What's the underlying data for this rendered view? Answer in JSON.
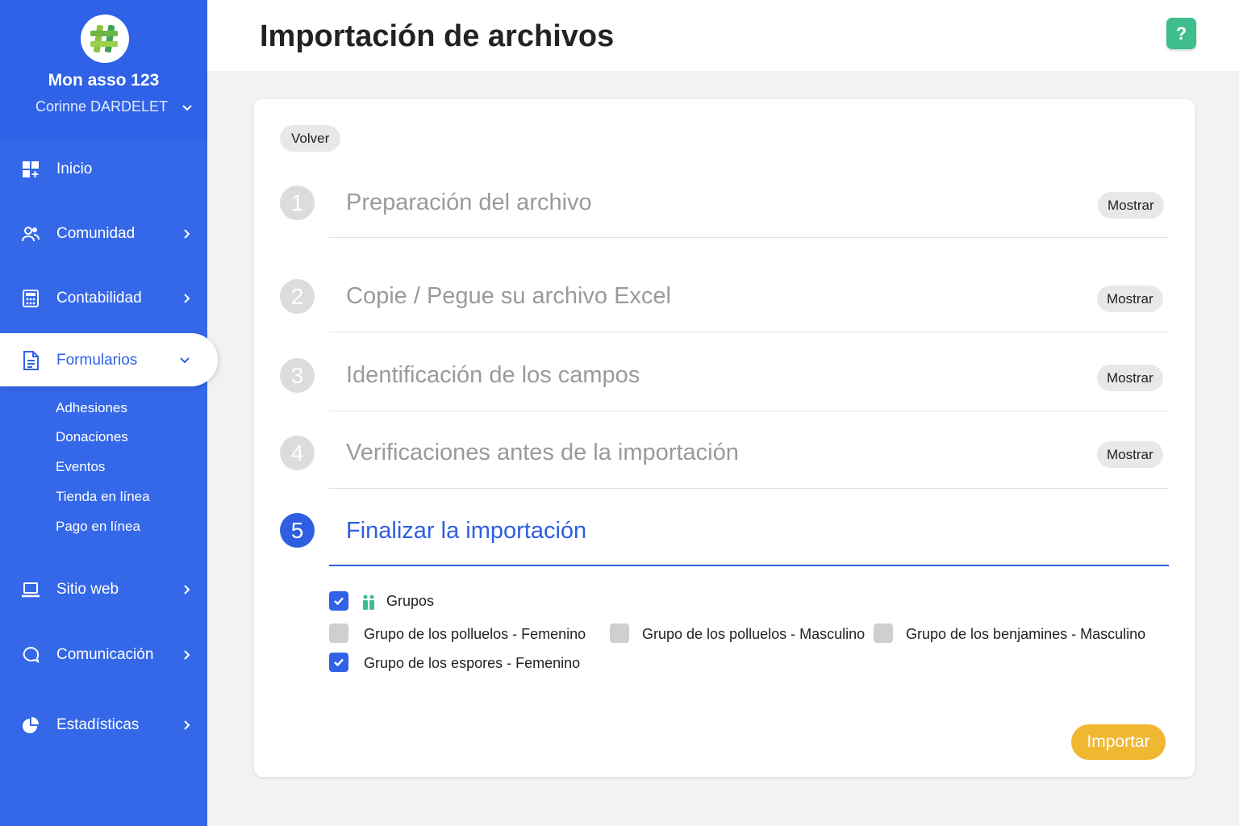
{
  "sidebar": {
    "org_name": "Mon asso 123",
    "user_name": "Corinne DARDELET",
    "items": [
      {
        "label": "Inicio",
        "icon": "dashboard-icon"
      },
      {
        "label": "Comunidad",
        "icon": "users-icon"
      },
      {
        "label": "Contabilidad",
        "icon": "calculator-icon"
      },
      {
        "label": "Formularios",
        "icon": "document-icon"
      },
      {
        "label": "Sitio web",
        "icon": "laptop-icon"
      },
      {
        "label": "Comunicación",
        "icon": "chat-icon"
      },
      {
        "label": "Estadísticas",
        "icon": "pie-chart-icon"
      }
    ],
    "subitems": [
      "Adhesiones",
      "Donaciones",
      "Eventos",
      "Tienda en línea",
      "Pago en línea"
    ]
  },
  "header": {
    "title": "Importación de archivos",
    "help_label": "?"
  },
  "card": {
    "back_label": "Volver",
    "show_label": "Mostrar",
    "steps": [
      {
        "num": "1",
        "title": "Preparación del archivo"
      },
      {
        "num": "2",
        "title": "Copie / Pegue su archivo Excel"
      },
      {
        "num": "3",
        "title": "Identificación de los campos"
      },
      {
        "num": "4",
        "title": "Verificaciones antes de la importación"
      },
      {
        "num": "5",
        "title": "Finalizar la importación"
      }
    ],
    "groups": {
      "label": "Grupos",
      "options": [
        {
          "label": "Grupo de los polluelos - Femenino",
          "checked": false
        },
        {
          "label": "Grupo de los polluelos - Masculino",
          "checked": false
        },
        {
          "label": "Grupo de los benjamines - Masculino",
          "checked": false
        },
        {
          "label": "Grupo de los espores - Femenino",
          "checked": true
        }
      ]
    },
    "import_label": "Importar"
  },
  "colors": {
    "sidebar": "#3568e8",
    "accent": "#2f5fe0",
    "import": "#f0b731",
    "help": "#3ebd8f"
  }
}
